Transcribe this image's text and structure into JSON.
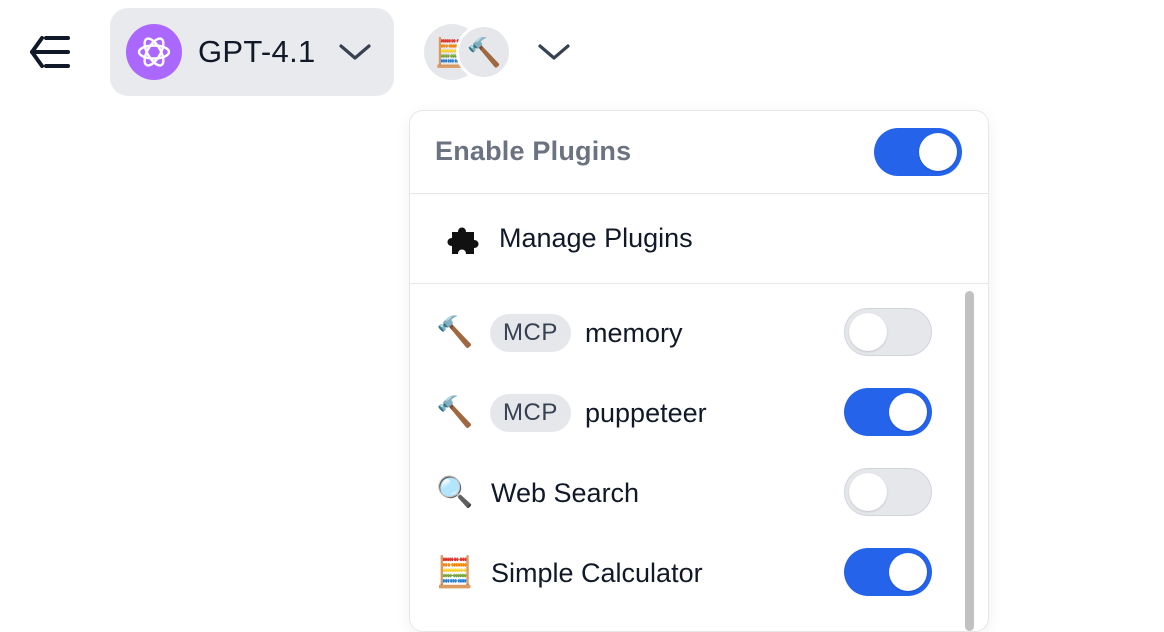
{
  "header": {
    "sidebar_toggle_icon": "collapse-sidebar-icon",
    "model": {
      "name": "GPT-4.1",
      "logo_icon": "openai-logo-icon",
      "logo_color": "#ab68ff",
      "chevron_icon": "chevron-down-icon"
    },
    "plugin_avatars": [
      {
        "icon": "abacus-icon",
        "glyph": "🧮"
      },
      {
        "icon": "hammer-icon",
        "glyph": "🔨"
      }
    ],
    "plugins_chevron_icon": "chevron-down-icon"
  },
  "dropdown": {
    "enable_label": "Enable Plugins",
    "enable_toggle": {
      "on": true
    },
    "manage": {
      "label": "Manage Plugins",
      "icon": "puzzle-piece-icon"
    },
    "plugins": [
      {
        "icon": "hammer-icon",
        "glyph": "🔨",
        "badge": "MCP",
        "name": "memory",
        "enabled": false
      },
      {
        "icon": "hammer-icon",
        "glyph": "🔨",
        "badge": "MCP",
        "name": "puppeteer",
        "enabled": true
      },
      {
        "icon": "magnifier-icon",
        "glyph": "🔍",
        "badge": "",
        "name": "Web Search",
        "enabled": false
      },
      {
        "icon": "abacus-icon",
        "glyph": "🧮",
        "badge": "",
        "name": "Simple Calculator",
        "enabled": true
      }
    ]
  },
  "colors": {
    "accent": "#2563eb",
    "toggle_off": "#e5e7eb",
    "model_pill_bg": "#e9eaed",
    "muted_text": "#6b7280"
  }
}
